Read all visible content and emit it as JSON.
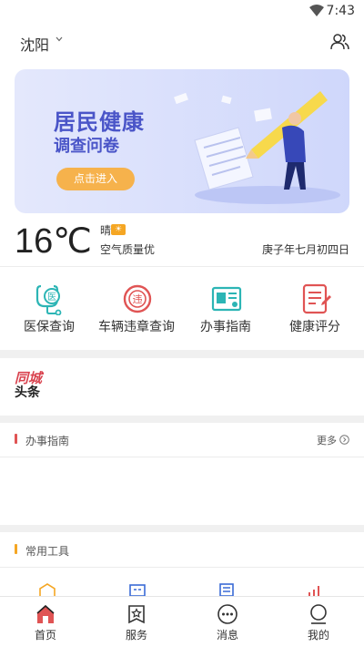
{
  "status_bar": {
    "time": "7:43",
    "wifi_icon": "wifi-icon"
  },
  "header": {
    "city": "沈阳",
    "city_icon": "chevron-down-icon",
    "contacts_icon": "people-icon"
  },
  "banner": {
    "title_line1": "居民健康",
    "title_line2": "调查问卷",
    "enter_label": "点击进入",
    "accent": "#4a55c8",
    "button_color": "#f6b24c"
  },
  "weather": {
    "temperature": "16℃",
    "condition": "晴",
    "condition_icon": "sun-icon",
    "condition_badge": "☀",
    "air_quality": "空气质量优",
    "lunar_date": "庚子年七月初四日"
  },
  "quick_services": [
    {
      "label": "医保查询",
      "icon": "medical-insurance-icon",
      "color": "#2cb5b5"
    },
    {
      "label": "车辆违章查询",
      "icon": "violation-icon",
      "color": "#e05454"
    },
    {
      "label": "办事指南",
      "icon": "id-card-icon",
      "color": "#2cb5b5"
    },
    {
      "label": "健康评分",
      "icon": "health-doc-icon",
      "color": "#e05454"
    }
  ],
  "news": {
    "logo_line1": "同城",
    "logo_line2": "头条"
  },
  "guide_section": {
    "title": "办事指南",
    "more_label": "更多",
    "bar_color": "#e05454"
  },
  "tools_section": {
    "title": "常用工具",
    "bar_color": "#f5a623"
  },
  "tabbar": [
    {
      "label": "首页",
      "icon": "home-icon"
    },
    {
      "label": "服务",
      "icon": "service-icon"
    },
    {
      "label": "消息",
      "icon": "message-icon"
    },
    {
      "label": "我的",
      "icon": "profile-icon"
    }
  ]
}
